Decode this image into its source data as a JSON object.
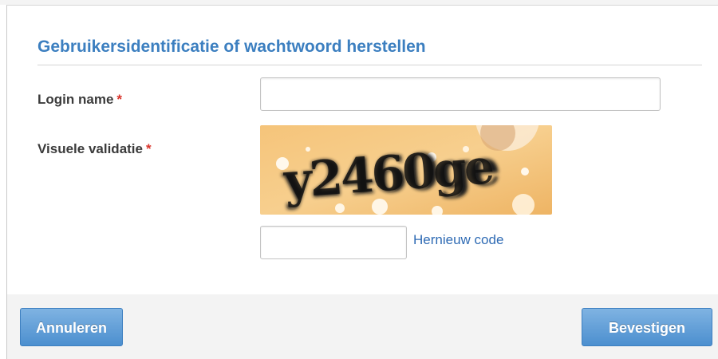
{
  "dialog": {
    "title": "Gebruikersidentificatie of wachtwoord herstellen"
  },
  "form": {
    "login": {
      "label": "Login name",
      "required_mark": "*",
      "value": ""
    },
    "captcha": {
      "label": "Visuele validatie",
      "required_mark": "*",
      "captcha_text": "y2460ge",
      "input_value": "",
      "refresh_link": "Hernieuw code"
    }
  },
  "footer": {
    "cancel_label": "Annuleren",
    "confirm_label": "Bevestigen"
  },
  "colors": {
    "accent": "#3c7fc0",
    "required": "#d9342b",
    "link": "#2f6bb4",
    "button_top": "#7fb3e2",
    "button_bottom": "#4c8fcf"
  }
}
